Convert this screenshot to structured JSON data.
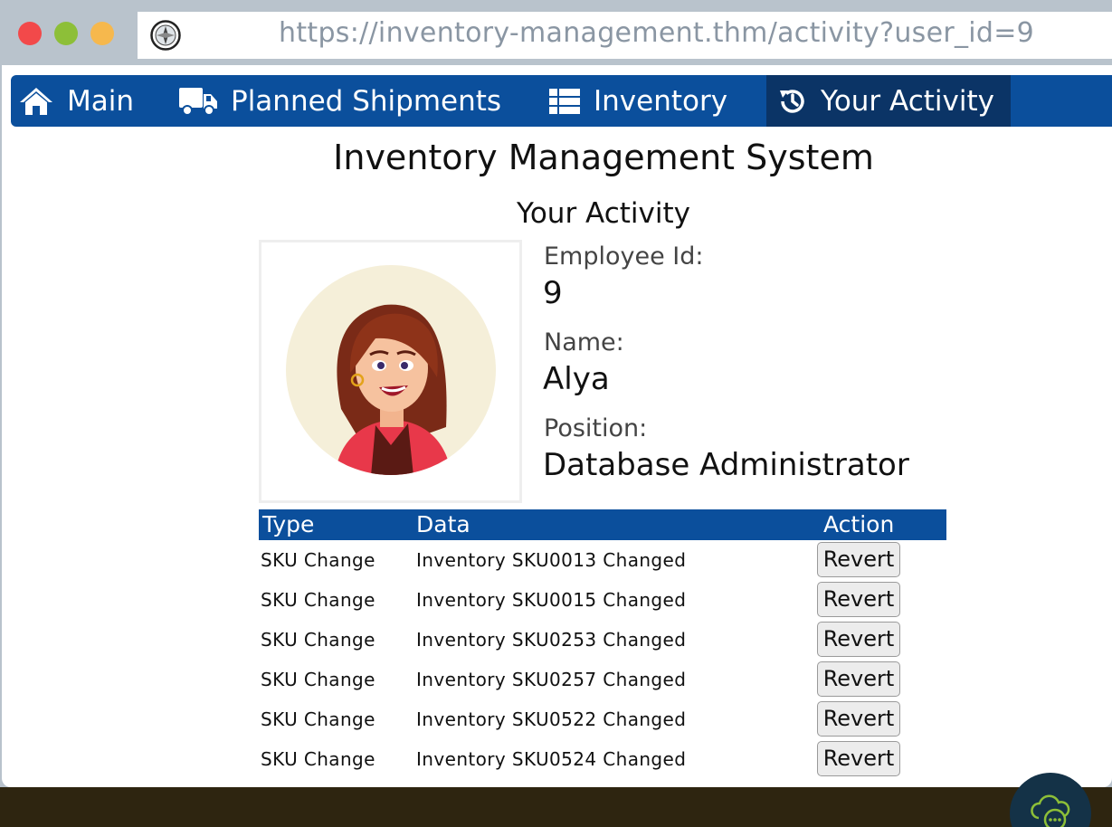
{
  "browser": {
    "url": "https://inventory-management.thm/activity?user_id=9"
  },
  "nav": {
    "items": [
      {
        "label": "Main",
        "icon": "home-icon"
      },
      {
        "label": "Planned Shipments",
        "icon": "truck-icon"
      },
      {
        "label": "Inventory",
        "icon": "list-icon"
      },
      {
        "label": "Your Activity",
        "icon": "history-icon",
        "active": true
      }
    ]
  },
  "page": {
    "title": "Inventory Management System",
    "subtitle": "Your Activity"
  },
  "profile": {
    "employee_id_label": "Employee Id:",
    "employee_id": "9",
    "name_label": "Name:",
    "name": "Alya",
    "position_label": "Position:",
    "position": "Database Administrator"
  },
  "table": {
    "headers": {
      "type": "Type",
      "data": "Data",
      "action": "Action"
    },
    "rows": [
      {
        "type": "SKU Change",
        "data": "Inventory SKU0013 Changed",
        "action": "Revert"
      },
      {
        "type": "SKU Change",
        "data": "Inventory SKU0015 Changed",
        "action": "Revert"
      },
      {
        "type": "SKU Change",
        "data": "Inventory SKU0253 Changed",
        "action": "Revert"
      },
      {
        "type": "SKU Change",
        "data": "Inventory SKU0257 Changed",
        "action": "Revert"
      },
      {
        "type": "SKU Change",
        "data": "Inventory SKU0522 Changed",
        "action": "Revert"
      },
      {
        "type": "SKU Change",
        "data": "Inventory SKU0524 Changed",
        "action": "Revert"
      }
    ]
  },
  "colors": {
    "nav_bg": "#0b4f9c",
    "nav_active_bg": "#0b3466",
    "table_header_bg": "#0b4f9c"
  }
}
